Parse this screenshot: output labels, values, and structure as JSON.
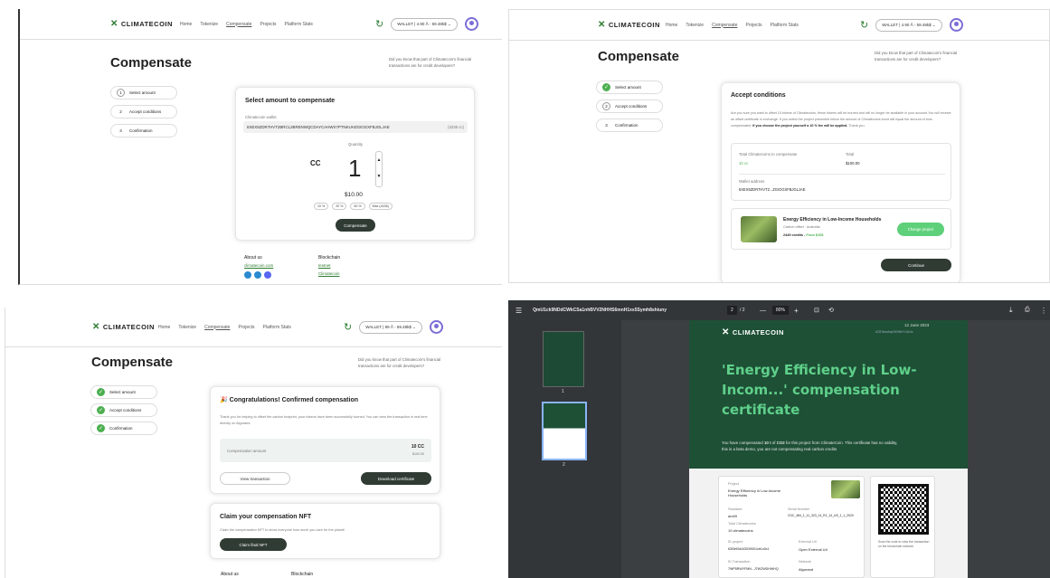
{
  "brand": {
    "name": "CLIMATECOIN"
  },
  "nav": {
    "home": "Home",
    "tokenize": "Tokenize",
    "compensate": "Compensate",
    "projects": "Projects",
    "platform_stats": "Platform Stats"
  },
  "wallet": {
    "label": "WALLET | 4.90 Å - 59.48k$ ⌄",
    "label2": "WALLET | 4.90 Å - 59.48k$ ⌄",
    "label3": "WALLET | 99 Å - 59.48k$ ⌄"
  },
  "page_title": "Compensate",
  "info_text": "Did you know that part of Climatecoin's financial transactions are for credit developers?",
  "steps": {
    "s1": "Select amount",
    "s2": "Accept conditions",
    "s3": "Confirmation",
    "n1": "1",
    "n2": "2",
    "n3": "3",
    "n3b": "3"
  },
  "select_card": {
    "title": "Select amount to compensate",
    "wallet_label": "Climatecoin wallet",
    "wallet_address": "6XEX5ZDR7HVT2BRCL2BRENWQCDAYCAHWX7PTNKUHZGIOGXFBJGLJAE",
    "wallet_balance": "(4235 cc)",
    "qty_label": "Quantity",
    "unit": "CC",
    "quantity": "1",
    "price": "$10.00",
    "pct10": "10 %",
    "pct20": "20 %",
    "pct50": "50 %",
    "max": "Max (4436)",
    "button": "Compensate"
  },
  "footer": {
    "about": "About us",
    "about_link": "climatecoin.com",
    "blockchain": "Blockchain",
    "testnet": "testnet",
    "climatecoin": "Climatecoin"
  },
  "accept_card": {
    "title": "Accept conditions",
    "body": "Are you sure you want to offset 10 tokens of Climatecoins, these tokens will be burned and will no longer be available in your account.You will receive an offset certificate in exchange. If you select the project presented below the amount of Climatecoins burnt will equal the amount of tons compensated.",
    "body_bold": "If you choose the project yourself a 10 % fee will be applied.",
    "body_end": "Thank you.",
    "total_label": "Total Climatecoins to compensate",
    "total_value": "10 cc",
    "cost_label": "Total",
    "cost_value": "$100.00",
    "wallet_label": "Wallet address",
    "wallet_value": "6XEX5ZDR7HVT2...ZGIOGXFBJGLJAE",
    "project_name": "Energy Efficiency in Low-Income Households",
    "project_sub": "Carbon offset · Australia",
    "project_credits": "2449 credits -",
    "project_price": "From $10$",
    "change_button": "Change project",
    "continue": "Continue"
  },
  "confirm_card": {
    "title": "🎉 Congratulations! Confirmed compensation",
    "body": "Thank you for helping to offset the carbon footprint, your tokens have been successfully burned. You can view the transaction in real time directly on Algorand.",
    "amount_label": "Compensation amount",
    "amount": "10 CC",
    "amount_usd": "$100.00",
    "view_btn": "View transaction",
    "download_btn": "Download certificate"
  },
  "nft_card": {
    "title": "Claim your compensation NFT",
    "body": "Claim the compensation NFT to show everyone how much you care for the planet!",
    "button": "Claim final NFT"
  },
  "footer3": {
    "about": "About us",
    "blockchain": "Blockchain"
  },
  "pdf": {
    "filename": "QmU1ck9NDdCWkCSa1nhBVV2NHHS6mnH1xs5Symh8shiuny",
    "page": "2",
    "pages": "/ 2",
    "zoom": "80%",
    "thumb1": "1",
    "thumb2": "2",
    "date": "12 June 2023",
    "doc_id": "#CBTahwAqnt3K9NhY1rt1cls",
    "title": "'Energy Efficiency in Low-Incom...' compensation certificate",
    "desc_pre": "You have compensated",
    "desc_qty": "10 t",
    "desc_of": "of",
    "desc_co2": "CO2",
    "desc_post": "for this project from ClimateCoin. This certificate has no validity, this is a beta demo, you are not compensating real carbon credits",
    "project_l": "Project",
    "project_v": "Energy Efficiency in Low-Income Households",
    "standard_l": "Standard",
    "standard_v": "arc69",
    "serial_l": "Serial Number",
    "serial_v": "CDC_484_1_11_323_14_R1_14_US_1_1_2020",
    "total_l": "Total Climatecoins",
    "total_v": "10 climatecoins",
    "id_l": "ID project",
    "id_v": "63f3ef3d443039001cb1c5c1",
    "ext_l": "External Url",
    "ext_v": "Open External Url",
    "tx_l": "ID Transaction",
    "tx_v": "7WP5RWYFMN...J7WZWDHWHQ",
    "net_l": "Network",
    "net_v": "Algorand",
    "qr_text": "Scan the code to view the transaction on the blockchain network"
  }
}
